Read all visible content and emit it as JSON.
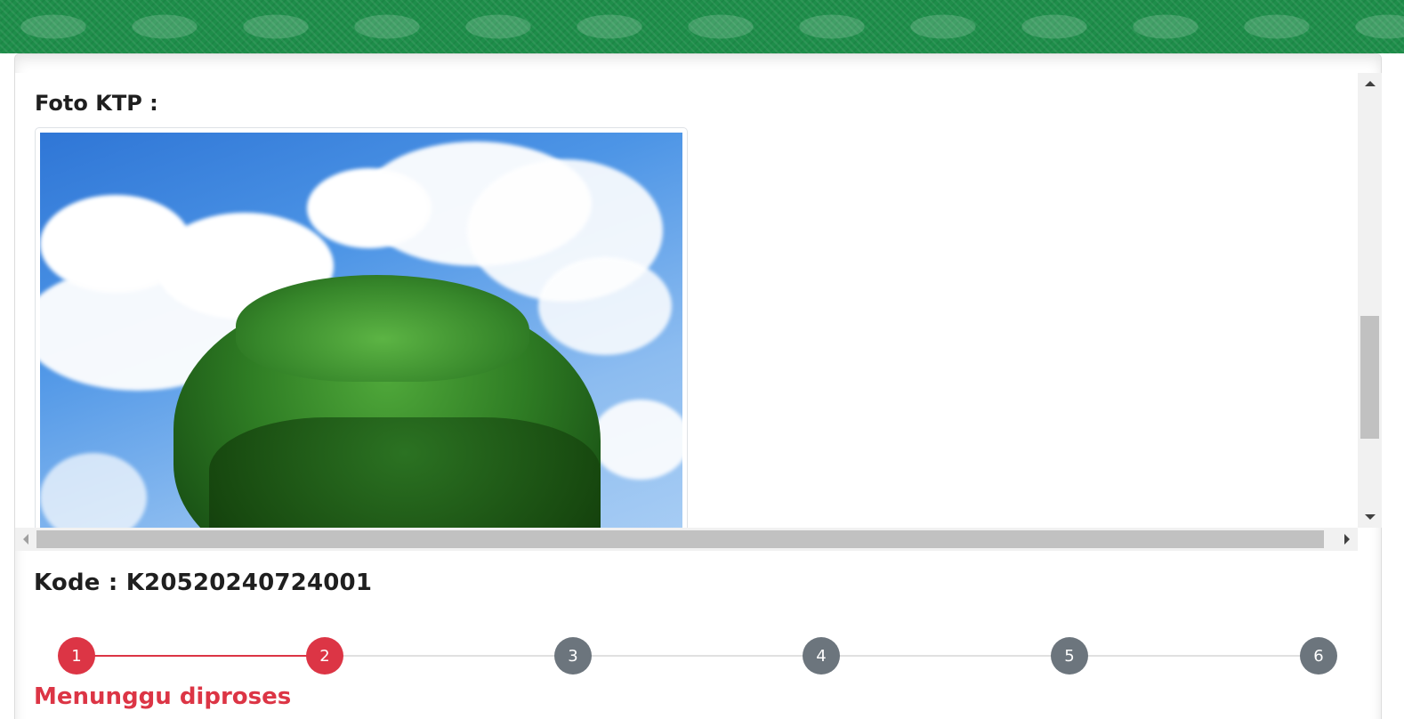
{
  "form": {
    "section_title": "Foto KTP :",
    "kode_label": "Kode : K20520240724001",
    "status_text": "Menunggu diproses"
  },
  "photo": {
    "subject": "tree-under-cloudy-sky-image"
  },
  "stepper": {
    "current_step": 2,
    "steps": [
      {
        "label": "1",
        "state": "active"
      },
      {
        "label": "2",
        "state": "active"
      },
      {
        "label": "3",
        "state": "inactive"
      },
      {
        "label": "4",
        "state": "inactive"
      },
      {
        "label": "5",
        "state": "inactive"
      },
      {
        "label": "6",
        "state": "inactive"
      }
    ]
  },
  "colors": {
    "accent_red": "#dc3545",
    "inactive_gray": "#6c757d",
    "banner_green": "#1e8e4a"
  }
}
